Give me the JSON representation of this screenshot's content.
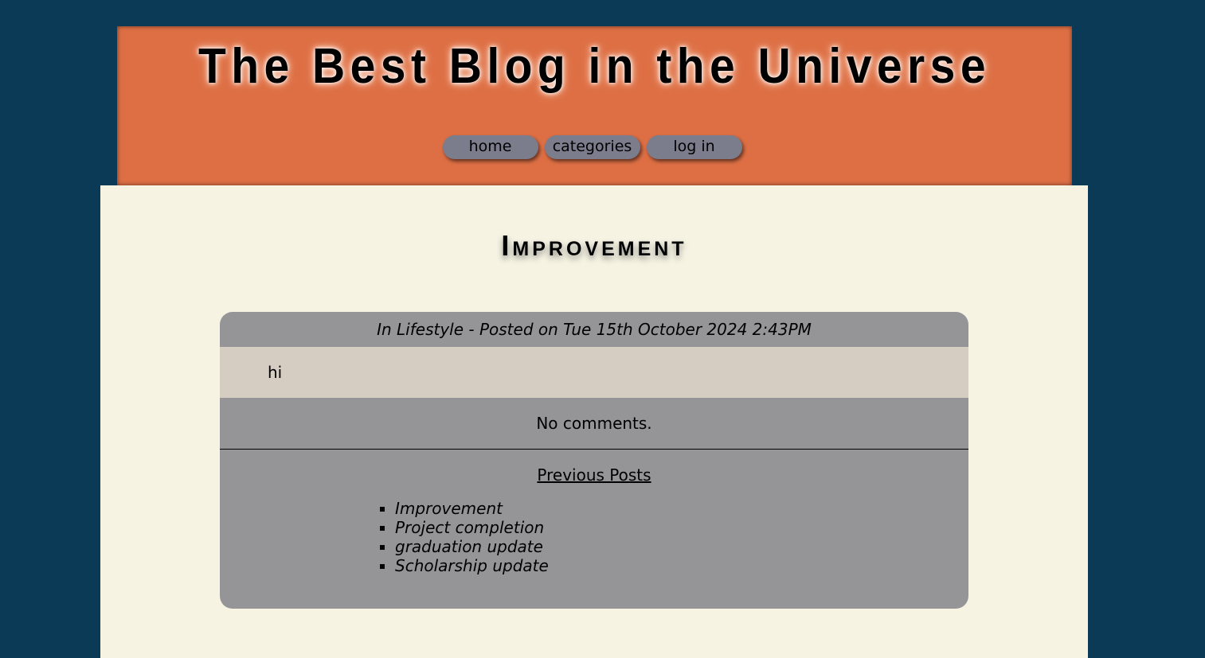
{
  "site": {
    "title": "The Best Blog in the Universe"
  },
  "nav": {
    "home": "home",
    "categories": "categories",
    "login": "log in"
  },
  "post": {
    "title": "Improvement",
    "meta": "In Lifestyle - Posted on Tue 15th October 2024 2:43PM",
    "body": "hi",
    "comments_text": "No comments."
  },
  "previous": {
    "heading": "Previous Posts",
    "items": [
      "Improvement",
      "Project completion",
      "graduation update",
      "Scholarship update"
    ]
  },
  "colors": {
    "page_bg": "#0b3a56",
    "header_bg": "#de6f45",
    "nav_button": "#7b7c8c",
    "content_bg": "#f6f3e3",
    "card_bg": "#959597",
    "post_body_bg": "#d5cdc2"
  }
}
